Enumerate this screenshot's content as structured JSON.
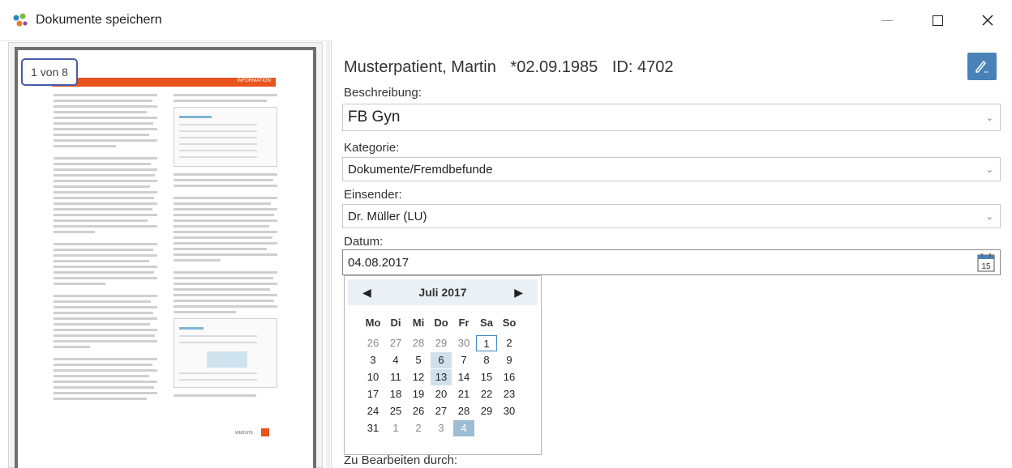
{
  "window": {
    "title": "Dokumente speichern",
    "icon": "app-logo-icon",
    "controls": [
      "minimize-icon",
      "maximize-icon",
      "close-icon"
    ]
  },
  "preview": {
    "page_counter": "1 von 8",
    "header_tag": "INFORMATION",
    "footer_tag": "WEBSITE"
  },
  "patient": {
    "name": "Musterpatient, Martin",
    "birth": "*02.09.1985",
    "id": "ID: 4702"
  },
  "edit_button_icon": "pencil-edit-icon",
  "fields": {
    "beschreibung": {
      "label": "Beschreibung:",
      "value": "FB Gyn"
    },
    "kategorie": {
      "label": "Kategorie:",
      "value": "Dokumente/Fremdbefunde"
    },
    "einsender": {
      "label": "Einsender:",
      "value": "Dr. Müller (LU)"
    },
    "datum": {
      "label": "Datum:",
      "value": "04.08.2017",
      "icon": "calendar-15-icon"
    },
    "zu_bearbeiten": {
      "label": "Zu Bearbeiten durch:"
    }
  },
  "calendar": {
    "month_label": "Juli 2017",
    "weekdays": [
      "Mo",
      "Di",
      "Mi",
      "Do",
      "Fr",
      "Sa",
      "So"
    ],
    "weeks": [
      [
        "26",
        "27",
        "28",
        "29",
        "30",
        "1",
        "2"
      ],
      [
        "3",
        "4",
        "5",
        "6",
        "7",
        "8",
        "9"
      ],
      [
        "10",
        "11",
        "12",
        "13",
        "14",
        "15",
        "16"
      ],
      [
        "17",
        "18",
        "19",
        "20",
        "21",
        "22",
        "23"
      ],
      [
        "24",
        "25",
        "26",
        "27",
        "28",
        "29",
        "30"
      ],
      [
        "31",
        "1",
        "2",
        "3",
        "4",
        "",
        ""
      ]
    ],
    "today": "1",
    "highlighted": [
      "6",
      "13"
    ],
    "selected": "4",
    "colors": {
      "header_bg": "#eaf0f5",
      "today_border": "#3f89c4",
      "highlight": "#cfe0ec",
      "selected": "#9bbcd3"
    }
  },
  "colors": {
    "accent": "#4a82b8",
    "document_orange": "#e8541c",
    "counter_border": "#4a5aa8"
  }
}
